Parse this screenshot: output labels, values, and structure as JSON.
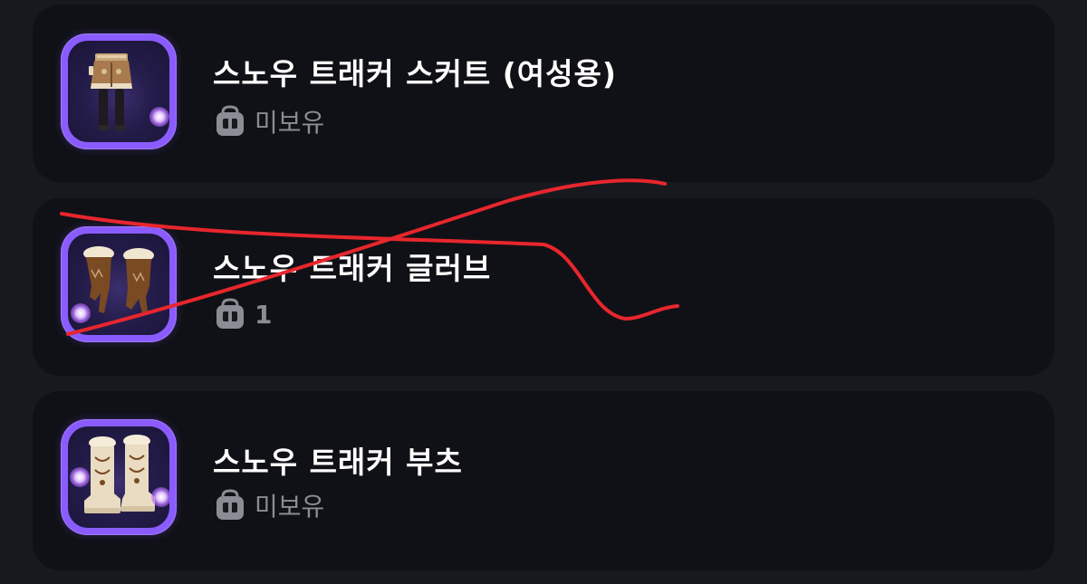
{
  "items": [
    {
      "name": "스노우 트래커 스커트 (여성용)",
      "status": "미보유",
      "icon": "skirt-icon"
    },
    {
      "name": "스노우 트래커 글러브",
      "status": "1",
      "icon": "gloves-icon"
    },
    {
      "name": "스노우 트래커 부츠",
      "status": "미보유",
      "icon": "boots-icon"
    }
  ],
  "status_icon": "bag-icon",
  "colors": {
    "background": "#17191e",
    "card": "#101116",
    "icon_frame": "#8a5cff",
    "name_text": "#ffffff",
    "status_text": "#8b8d94",
    "scribble": "#e8262d"
  }
}
